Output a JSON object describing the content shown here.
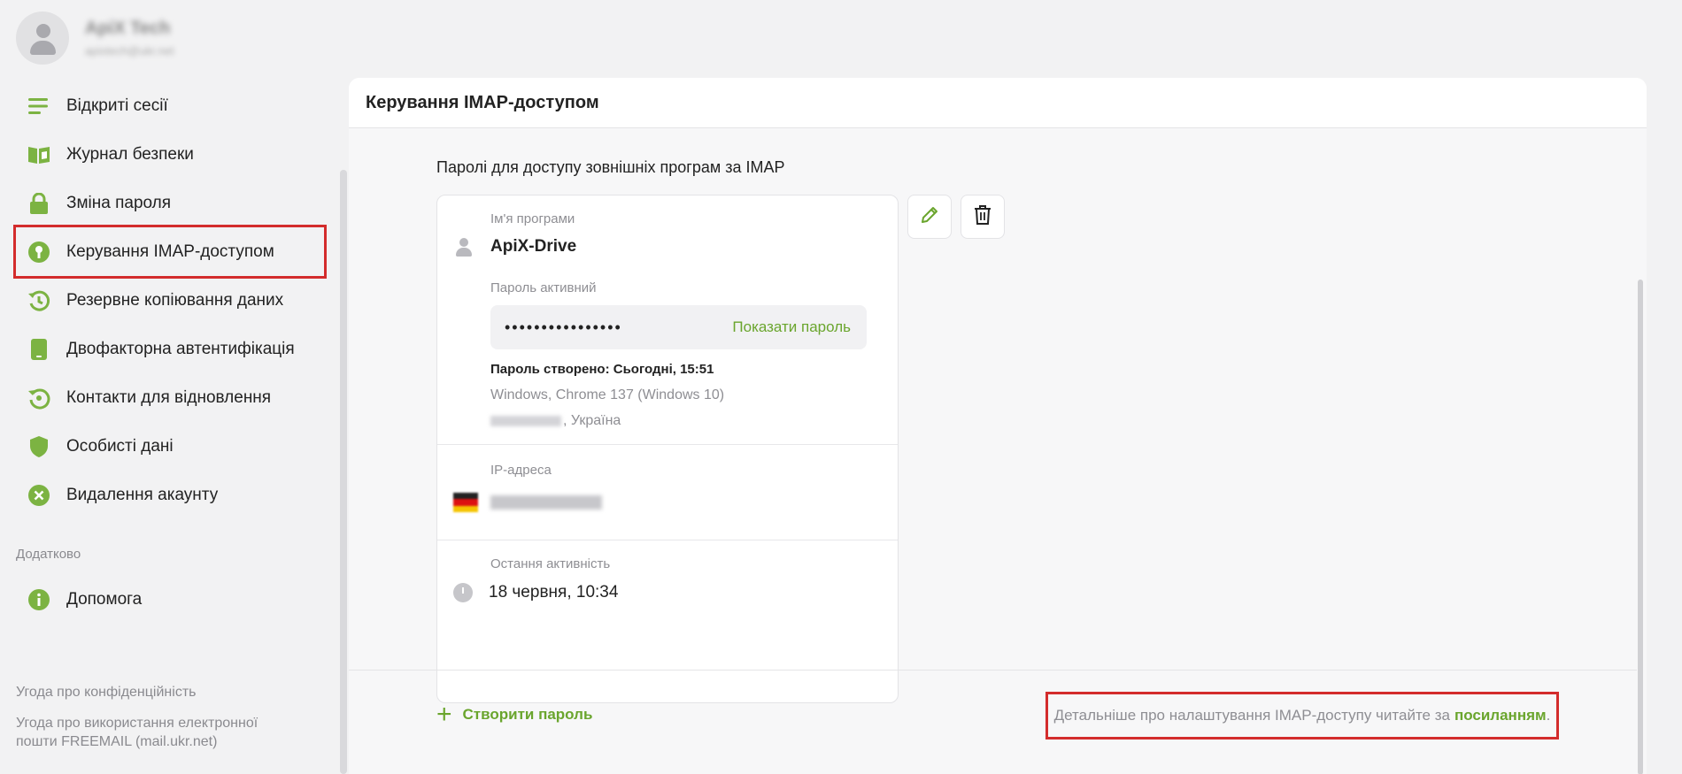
{
  "profile": {
    "name": "ApiX Tech",
    "email": "apixtech@ukr.net"
  },
  "nav": {
    "items": [
      {
        "label": "Відкриті сесії",
        "icon": "list-lines-icon"
      },
      {
        "label": "Журнал безпеки",
        "icon": "book-icon"
      },
      {
        "label": "Зміна пароля",
        "icon": "lock-icon"
      },
      {
        "label": "Керування IMAP-доступом",
        "icon": "key-circle-icon"
      },
      {
        "label": "Резервне копіювання даних",
        "icon": "backup-history-icon"
      },
      {
        "label": "Двофакторна автентифікація",
        "icon": "phone-icon"
      },
      {
        "label": "Контакти для відновлення",
        "icon": "restore-icon"
      },
      {
        "label": "Особисті дані",
        "icon": "shield-icon"
      },
      {
        "label": "Видалення акаунту",
        "icon": "remove-circle-icon"
      }
    ],
    "extra_label": "Додатково",
    "help_label": "Допомога"
  },
  "footer": {
    "privacy": "Угода про конфіденційність",
    "terms": "Угода про використання електронної пошти FREEMAIL (mail.ukr.net)"
  },
  "main": {
    "title": "Керування IMAP-доступом",
    "section_title": "Паролі для доступу зовнішніх програм за IMAP",
    "card": {
      "program_label": "Ім'я програми",
      "program_name": "ApiX-Drive",
      "password_status": "Пароль активний",
      "password_mask": "••••••••••••••••",
      "show_password": "Показати пароль",
      "created": "Пароль створено: Сьогодні, 15:51",
      "device": "Windows, Chrome 137 (Windows 10)",
      "country": ", Україна",
      "ip_label": "IP-адреса",
      "last_label": "Остання активність",
      "last_value": "18 червня, 10:34"
    },
    "create_password": "Створити пароль",
    "help_text": "Детальніше про налаштування IMAP-доступу читайте за",
    "help_link": "посиланням",
    "help_period": "."
  },
  "colors": {
    "accent": "#6aa52d",
    "highlight": "#d32c2c"
  }
}
